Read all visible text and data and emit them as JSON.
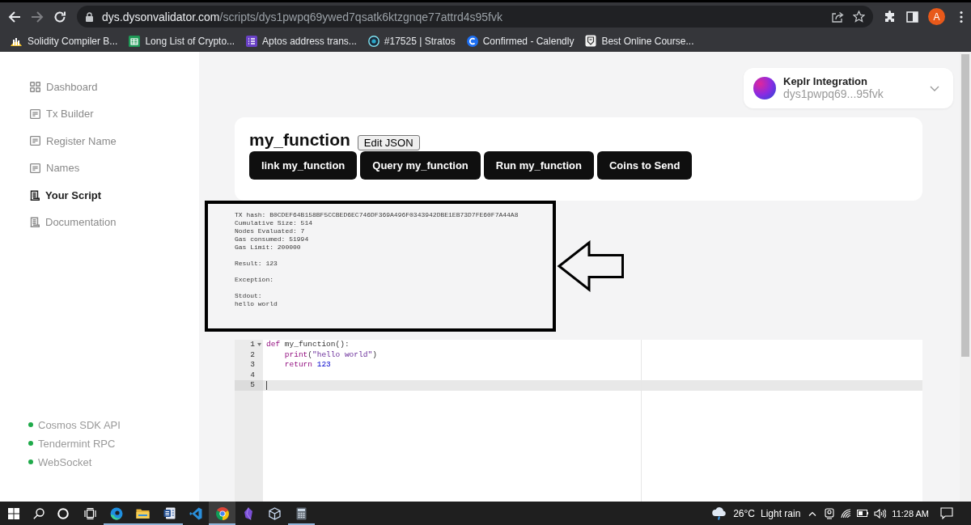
{
  "browser": {
    "back_disabled": false,
    "forward_disabled": true,
    "url_host": "dys.dysonvalidator.com",
    "url_path": "/scripts/dys1pwpq69ywed7qsatk6ktzgnqe77attrd4s95fvk",
    "profile_initial": "A"
  },
  "bookmarks": [
    {
      "label": "Solidity Compiler B...",
      "kind": "bars"
    },
    {
      "label": "Long List of Crypto...",
      "kind": "sheet"
    },
    {
      "label": "Aptos address trans...",
      "kind": "list"
    },
    {
      "label": "#17525 | Stratos",
      "kind": "ring"
    },
    {
      "label": "Confirmed - Calendly",
      "kind": "arc"
    },
    {
      "label": "Best Online Course...",
      "kind": "shield"
    }
  ],
  "sidebar": {
    "items": [
      {
        "label": "Dashboard",
        "kind": "grid",
        "selected": false
      },
      {
        "label": "Tx Builder",
        "kind": "doc",
        "selected": false
      },
      {
        "label": "Register Name",
        "kind": "doc",
        "selected": false
      },
      {
        "label": "Names",
        "kind": "doc",
        "selected": false
      },
      {
        "label": "Your Script",
        "kind": "scroll",
        "selected": true
      },
      {
        "label": "Documentation",
        "kind": "scroll",
        "selected": false
      }
    ],
    "links": [
      {
        "label": "Cosmos SDK API",
        "connected": true
      },
      {
        "label": "Tendermint RPC",
        "connected": true
      },
      {
        "label": "WebSocket",
        "connected": true
      }
    ]
  },
  "wallet": {
    "title": "Keplr Integration",
    "address": "dys1pwpq69...95fvk"
  },
  "script": {
    "title": "my_function",
    "edit_button": "Edit JSON",
    "actions": [
      "link my_function",
      "Query my_function",
      "Run my_function",
      "Coins to Send"
    ]
  },
  "output": {
    "blocks": [
      [
        "TX hash: B0CDEF64B158BF5CCBED6EC746DF369A496F0343942DBE1EB73D7FE60F7A44A8",
        "Cumulative Size: 514",
        "Nodes Evaluated: 7",
        "Gas consumed: 51994",
        "Gas Limit: 200000"
      ],
      [
        "Result: 123"
      ],
      [
        "Exception:"
      ],
      [
        "Stdout:",
        "hello world"
      ]
    ]
  },
  "editor": {
    "lines": [
      {
        "number": "1",
        "foldable": true,
        "active": false,
        "cursor": false,
        "tokens": [
          {
            "kind": "keyword",
            "text": "def"
          },
          {
            "kind": "plain",
            "text": " my_function():"
          }
        ]
      },
      {
        "number": "2",
        "foldable": false,
        "active": false,
        "cursor": false,
        "tokens": [
          {
            "kind": "builtin",
            "text": "    print"
          },
          {
            "kind": "plain",
            "text": "("
          },
          {
            "kind": "string",
            "text": "\"hello world\""
          },
          {
            "kind": "plain",
            "text": ")"
          }
        ]
      },
      {
        "number": "3",
        "foldable": false,
        "active": false,
        "cursor": false,
        "tokens": [
          {
            "kind": "keyword",
            "text": "    return"
          },
          {
            "kind": "number",
            "text": " 123"
          }
        ]
      },
      {
        "number": "4",
        "foldable": false,
        "active": false,
        "cursor": false
      },
      {
        "number": "5",
        "foldable": false,
        "active": true,
        "cursor": true
      }
    ]
  },
  "taskbar": {
    "apps": [
      {
        "kind": "swirl",
        "selected": false,
        "running": true
      },
      {
        "kind": "folder",
        "selected": false,
        "running": true
      },
      {
        "kind": "document",
        "selected": false,
        "running": true
      },
      {
        "kind": "ribbon",
        "selected": false,
        "running": false
      },
      {
        "kind": "wheel",
        "selected": true,
        "running": true
      },
      {
        "kind": "gem",
        "selected": false,
        "running": false
      },
      {
        "kind": "cube",
        "selected": false,
        "running": false
      },
      {
        "kind": "calculator",
        "selected": false,
        "running": true
      }
    ],
    "weather": {
      "temperature": "26°C",
      "condition": "Light rain"
    },
    "clock": "11:28 AM"
  }
}
